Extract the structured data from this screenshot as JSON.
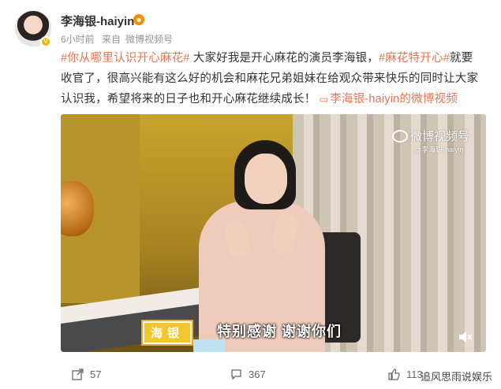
{
  "post": {
    "username": "李海银-haiyin",
    "badge_icon": "gold-v-badge",
    "meta": {
      "time": "6小时前",
      "source_prefix": "来自",
      "source": "微博视频号"
    },
    "text_parts": {
      "tag1": "#你从哪里认识开心麻花#",
      "text1": " 大家好我是开心麻花的演员李海银，",
      "tag2": "#麻花特开心#",
      "text2": "就要收官了，很高兴能有这么好的机会和麻花兄弟姐妹在给观众带来快乐的同时让大家认识我，希望将来的日子也和开心麻花继续成长！",
      "link": "李海银-haiyin的微博视频"
    }
  },
  "video": {
    "watermark_title": "微博视频号",
    "watermark_sub": "@李海银-haiyin",
    "caption_name": "海银",
    "caption_text": "特别感谢 谢谢你们"
  },
  "actions": {
    "repost_count": "57",
    "comment_count": "367",
    "like_count": "113"
  },
  "page_watermark": "追风思雨说娱乐",
  "colors": {
    "accent": "#eb7350",
    "meta_gray": "#939393",
    "badge": "#f7b500"
  }
}
